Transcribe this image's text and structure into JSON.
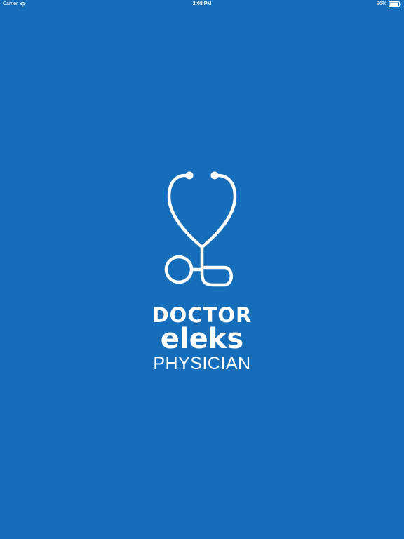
{
  "status_bar": {
    "carrier": "Carrier",
    "wifi_icon": "wifi-icon",
    "time": "2:08 PM",
    "battery_percent": "96%",
    "battery_icon": "battery-icon",
    "battery_level": 0.96
  },
  "splash": {
    "logo_icon": "stethoscope-icon",
    "brand_line1": "DOCTOR",
    "brand_line2": "eleks",
    "brand_line3": "PHYSICIAN",
    "background_color": "#166dba",
    "foreground_color": "#ffffff"
  }
}
